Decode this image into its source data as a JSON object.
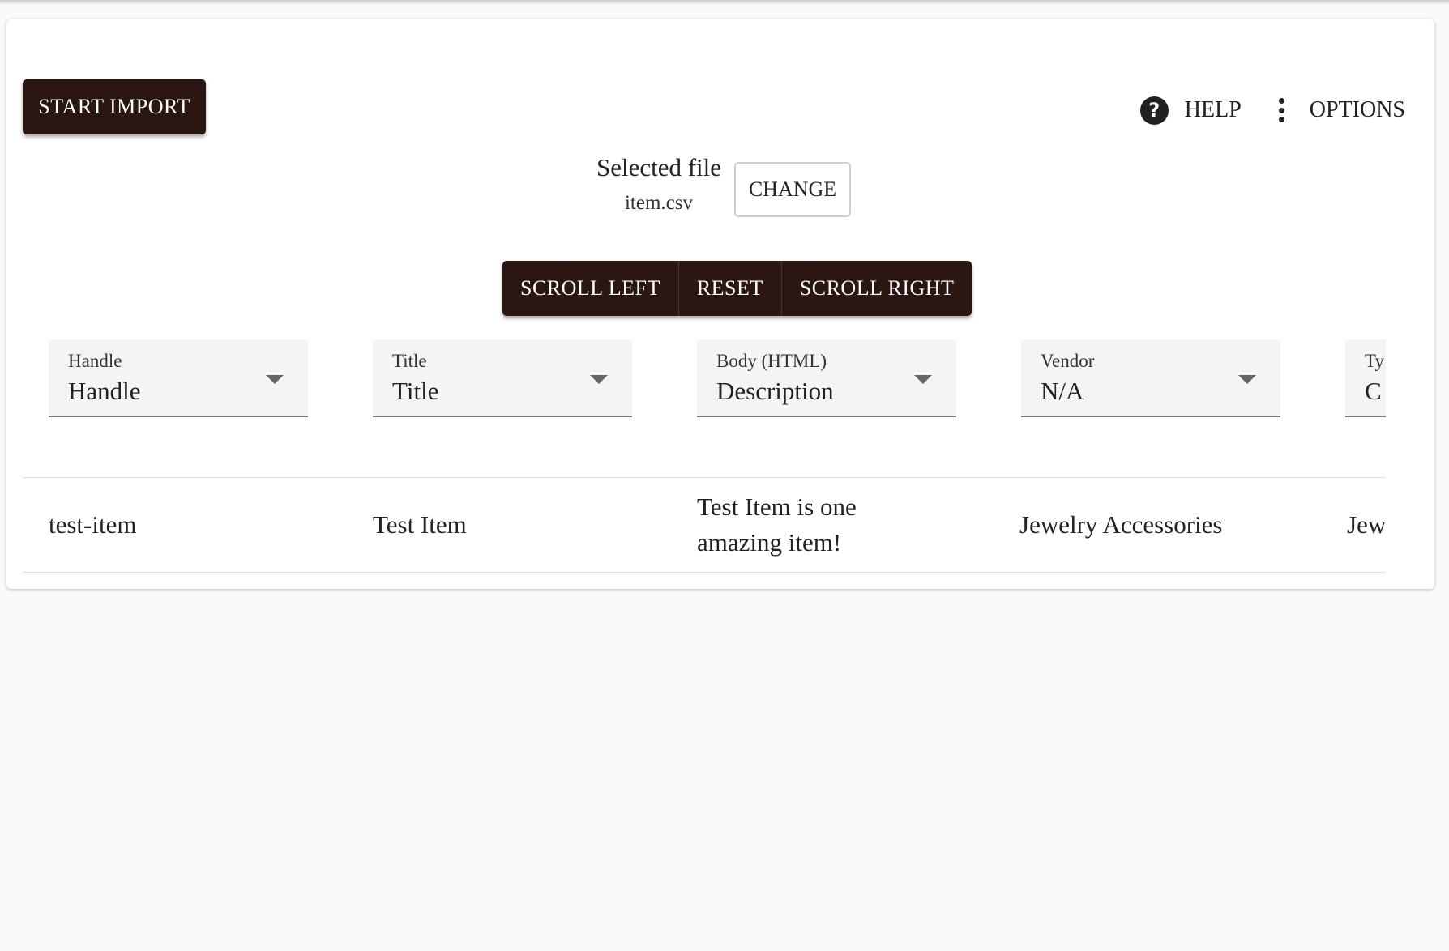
{
  "toolbar": {
    "start_import_label": "START IMPORT",
    "help_label": "HELP",
    "help_icon_glyph": "?",
    "options_label": "OPTIONS"
  },
  "file": {
    "heading": "Selected file",
    "name": "item.csv",
    "change_label": "CHANGE"
  },
  "navigation": {
    "scroll_left_label": "SCROLL LEFT",
    "reset_label": "RESET",
    "scroll_right_label": "SCROLL RIGHT"
  },
  "columns": [
    {
      "label": "Handle",
      "selected": "Handle"
    },
    {
      "label": "Title",
      "selected": "Title"
    },
    {
      "label": "Body (HTML)",
      "selected": "Description"
    },
    {
      "label": "Vendor",
      "selected": "N/A"
    },
    {
      "label": "Ty",
      "selected": "C"
    }
  ],
  "rows": [
    {
      "cells": [
        "test-item",
        "Test Item",
        "Test Item is one amazing item!",
        "Jewelry Accessories",
        "Jew"
      ]
    }
  ],
  "colors": {
    "button_dark": "#2b1712",
    "background": "#fafafa",
    "select_bg": "#f4f4f4"
  }
}
